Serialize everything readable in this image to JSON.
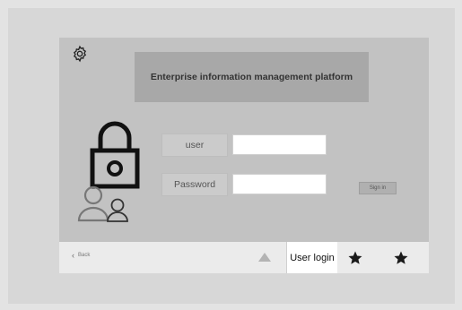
{
  "header": {
    "title": "Enterprise information management platform",
    "settings_icon": "gear-icon"
  },
  "login": {
    "user_label": "user",
    "user_value": "",
    "password_label": "Password",
    "password_value": "",
    "sign_in_label": "Sign in"
  },
  "icons": {
    "lock": "lock-icon",
    "users": "users-icon"
  },
  "footer": {
    "back_label": "Back",
    "tab_label": "User login",
    "star_icon": "star-icon",
    "up_icon": "triangle-up-icon"
  },
  "colors": {
    "panel": "#c2c2c2",
    "title_bg": "#a8a8a8",
    "bar": "#ebebeb"
  }
}
